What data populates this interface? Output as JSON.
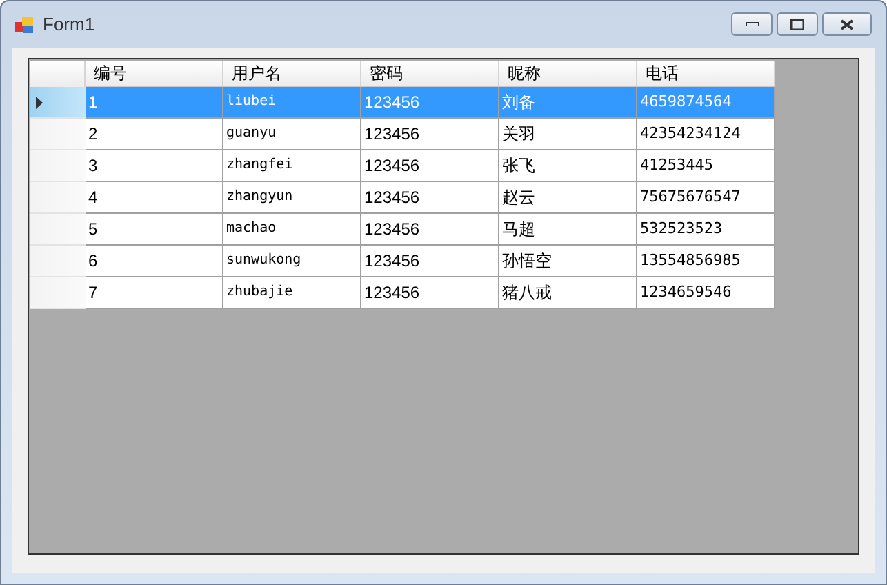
{
  "window": {
    "title": "Form1"
  },
  "table": {
    "columns": [
      "编号",
      "用户名",
      "密码",
      "昵称",
      "电话"
    ],
    "rows": [
      {
        "selected": true,
        "cells": [
          "1",
          "liubei",
          "123456",
          "刘备",
          "4659874564"
        ]
      },
      {
        "selected": false,
        "cells": [
          "2",
          "guanyu",
          "123456",
          "关羽",
          "42354234124"
        ]
      },
      {
        "selected": false,
        "cells": [
          "3",
          "zhangfei",
          "123456",
          "张飞",
          "41253445"
        ]
      },
      {
        "selected": false,
        "cells": [
          "4",
          "zhangyun",
          "123456",
          "赵云",
          "75675676547"
        ]
      },
      {
        "selected": false,
        "cells": [
          "5",
          "machao",
          "123456",
          "马超",
          "532523523"
        ]
      },
      {
        "selected": false,
        "cells": [
          "6",
          "sunwukong",
          "123456",
          "孙悟空",
          "13554856985"
        ]
      },
      {
        "selected": false,
        "cells": [
          "7",
          "zhubajie",
          "123456",
          "猪八戒",
          "1234659546"
        ]
      }
    ]
  }
}
